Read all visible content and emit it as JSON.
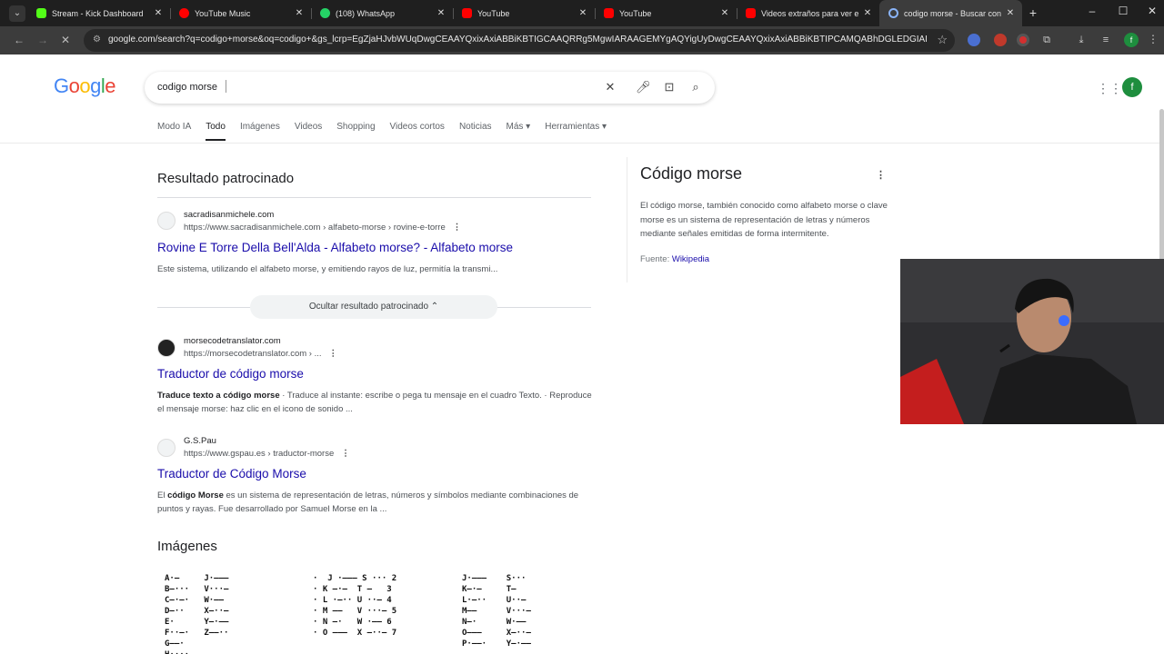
{
  "browser": {
    "tabs": [
      {
        "title": "Stream - Kick Dashboard",
        "color": "#53fc18"
      },
      {
        "title": "YouTube Music",
        "color": "#ff0000"
      },
      {
        "title": "(108) WhatsApp",
        "color": "#25d366"
      },
      {
        "title": "YouTube",
        "color": "#ff0000"
      },
      {
        "title": "YouTube",
        "color": "#ff0000"
      },
      {
        "title": "Videos extraños para ver e",
        "color": "#ff0000"
      },
      {
        "title": "codigo morse - Buscar con",
        "color": "#8ab4f8"
      }
    ],
    "url": "google.com/search?q=codigo+morse&oq=codigo+&gs_lcrp=EgZjaHJvbWUqDwgCEAAYQxixAxiABBiKBTIGCAAQRRg5MgwIARAAGEMYgAQYigUyDwgCEAAYQxixAxiABBiKBTIPCAMQABhDGLEDGIAEG..."
  },
  "google": {
    "logo": "Google",
    "query": "codigo morse",
    "avatar_letter": "f",
    "filters": [
      "Modo IA",
      "Todo",
      "Imágenes",
      "Videos",
      "Shopping",
      "Videos cortos",
      "Noticias",
      "Más ▾",
      "Herramientas ▾"
    ]
  },
  "sponsored": {
    "heading": "Resultado patrocinado",
    "site": "sacradisanmichele.com",
    "path": "https://www.sacradisanmichele.com › alfabeto-morse › rovine-e-torre",
    "title": "Rovine E Torre Della Bell'Alda - Alfabeto morse? - Alfabeto morse",
    "snippet": "Este sistema, utilizando el alfabeto morse, y emitiendo rayos de luz, permitía la transmi...",
    "hide_label": "Ocultar resultado patrocinado  ⌃"
  },
  "results": [
    {
      "site": "morsecodetranslator.com",
      "path": "https://morsecodetranslator.com › ...",
      "title": "Traductor de código morse",
      "snippet_bold": "Traduce texto a código morse",
      "snippet": " · Traduce al instante: escribe o pega tu mensaje en el cuadro Texto. · Reproduce el mensaje morse: haz clic en el icono de sonido ..."
    },
    {
      "site": "G.S.Pau",
      "path": "https://www.gspau.es › traductor-morse",
      "title": "Traductor de Código Morse",
      "snippet_pre": "El ",
      "snippet_bold": "código Morse",
      "snippet": " es un sistema de representación de letras, números y símbolos mediante combinaciones de puntos y rayas. Fue desarrollado por Samuel Morse en la ..."
    }
  ],
  "images": {
    "heading": "Imágenes",
    "tiles": [
      "A·—     J·———\nB—···   V···—\nC—·—·   W·——\nD—··    X—··—\nE·      Y—·——\nF··—·   Z——··\nG——·\nH····",
      "·  J ·——— S ··· 2\n· K —·—  T —   3\n· L ·—·· U ··— 4\n· M ——   V ···— 5\n· N —·   W ·—— 6\n· O ———  X —··— 7",
      "J·———    S···\nK—·—     T—\nL·—··    U··—\nM——      V···—\nN—·      W·——\nO———     X—··—\nP·——·    Y—·——"
    ]
  },
  "knowledge_panel": {
    "title": "Código morse",
    "description": "El código morse, también conocido como alfabeto morse o clave morse es un sistema de representación de letras y números mediante señales emitidas de forma intermitente.",
    "source_label": "Fuente: ",
    "source_link": "Wikipedia"
  }
}
